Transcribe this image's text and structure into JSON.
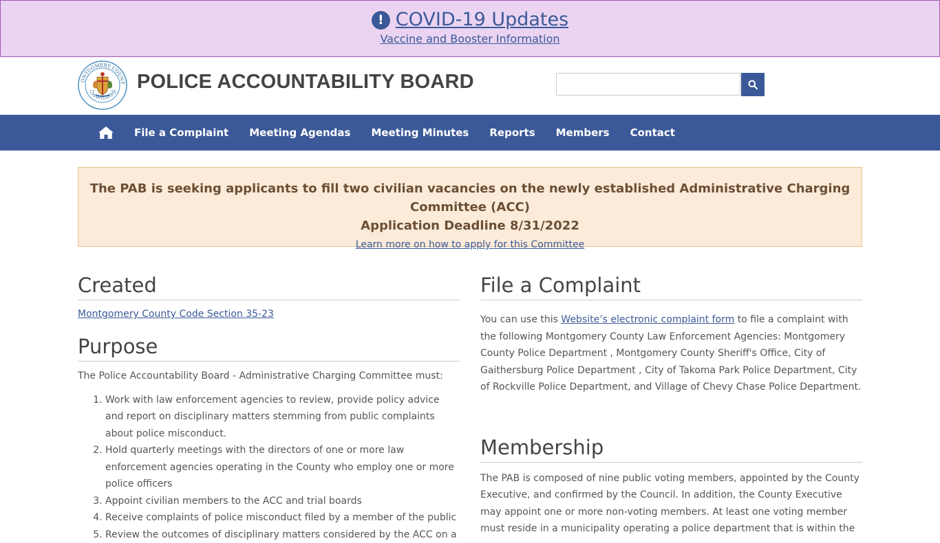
{
  "banner": {
    "title": "COVID-19 Updates",
    "subtitle": "Vaccine and Booster Information",
    "icon": "exclamation-circle-icon"
  },
  "header": {
    "site_title": "POLICE ACCOUNTABILITY BOARD",
    "seal_text_top": "MONTGOMERY COUNTY",
    "seal_text_bottom": "MARYLAND",
    "seal_year_left": "17",
    "seal_year_right": "76",
    "search_placeholder": "",
    "search_icon": "search-icon"
  },
  "nav": {
    "home_icon": "home-icon",
    "items": [
      "File a Complaint",
      "Meeting Agendas",
      "Meeting Minutes",
      "Reports",
      "Members",
      "Contact"
    ]
  },
  "notice": {
    "line1": "The PAB is seeking applicants to fill two civilian vacancies on the newly established Administrative Charging Committee (ACC)",
    "line2": "Application Deadline 8/31/2022",
    "link": "Learn more on how to apply for this Committee"
  },
  "left": {
    "created_heading": "Created",
    "created_link": "Montgomery County Code Section 35-23",
    "purpose_heading": "Purpose",
    "purpose_intro": "The Police Accountability Board - Administrative Charging Committee must:",
    "purpose_items": [
      "Work with law enforcement agencies to review, provide policy advice and report on disciplinary matters stemming from public complaints about police misconduct.",
      "Hold quarterly meetings with the directors of one or more law enforcement agencies operating in the County who employ one or more police officers",
      "Appoint civilian members to the ACC and trial boards",
      "Receive complaints of police misconduct filed by a member of the public",
      "Review the outcomes of disciplinary matters considered by the ACC on a"
    ]
  },
  "right": {
    "complaint_heading": "File a Complaint",
    "complaint_pre": "You can use this ",
    "complaint_link": "Website’s electronic complaint form",
    "complaint_post": " to file a complaint with the following Montgomery County Law Enforcement Agencies: Montgomery County Police Department , Montgomery County Sheriff's Office, City of Gaithersburg Police Department , City of Takoma Park Police Department, City of Rockville Police Department, and Village of Chevy Chase Police Department.",
    "membership_heading": "Membership",
    "membership_text": "The PAB is composed of nine public voting members, appointed by the County Executive, and confirmed by the Council. In addition, the County Executive may appoint one or more non-voting members. At least one voting member must reside in a municipality operating a police department that is within the"
  },
  "colors": {
    "accent": "#3b5998",
    "banner_bg": "#ead4f2",
    "notice_bg": "#fcebd8"
  }
}
